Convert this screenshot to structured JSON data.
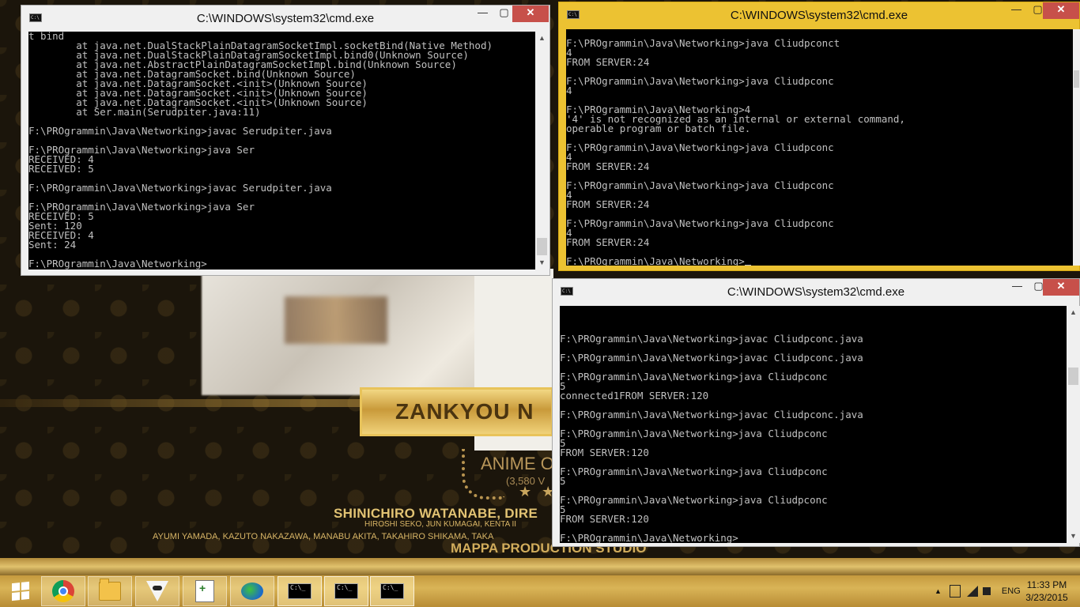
{
  "wallpaper": {
    "banner_text": "ZANKYOU N",
    "anime_of": "ANIME OF",
    "count": "(3,580 V",
    "stars": "★ ★",
    "line1": "SHINICHIRO WATANABE, DIRE",
    "line2": "HIROSHI SEKO, JUN KUMAGAI, KENTA II",
    "line3": "AYUMI YAMADA, KAZUTO NAKAZAWA, MANABU AKITA, TAKAHIRO SHIKAMA, TAKA",
    "line4": "MAPPA PRODUCTION STUDIO"
  },
  "windows": {
    "left": {
      "title": "C:\\WINDOWS\\system32\\cmd.exe",
      "icon_label": "C:\\",
      "minimize": "—",
      "maximize": "▢",
      "close": "✕",
      "lines": [
        "t bind",
        "        at java.net.DualStackPlainDatagramSocketImpl.socketBind(Native Method)",
        "        at java.net.DualStackPlainDatagramSocketImpl.bind0(Unknown Source)",
        "        at java.net.AbstractPlainDatagramSocketImpl.bind(Unknown Source)",
        "        at java.net.DatagramSocket.bind(Unknown Source)",
        "        at java.net.DatagramSocket.<init>(Unknown Source)",
        "        at java.net.DatagramSocket.<init>(Unknown Source)",
        "        at java.net.DatagramSocket.<init>(Unknown Source)",
        "        at Ser.main(Serudpiter.java:11)",
        "",
        "F:\\PROgrammin\\Java\\Networking>javac Serudpiter.java",
        "",
        "F:\\PROgrammin\\Java\\Networking>java Ser",
        "RECEIVED: 4",
        "RECEIVED: 5",
        "",
        "F:\\PROgrammin\\Java\\Networking>javac Serudpiter.java",
        "",
        "F:\\PROgrammin\\Java\\Networking>java Ser",
        "RECEIVED: 5",
        "Sent: 120",
        "RECEIVED: 4",
        "Sent: 24",
        "",
        "F:\\PROgrammin\\Java\\Networking>"
      ]
    },
    "right_top": {
      "title": "C:\\WINDOWS\\system32\\cmd.exe",
      "icon_label": "C:\\",
      "minimize": "—",
      "maximize": "▢",
      "close": "✕",
      "lines": [
        "",
        "F:\\PROgrammin\\Java\\Networking>java Cliudpconct",
        "4",
        "FROM SERVER:24",
        "",
        "F:\\PROgrammin\\Java\\Networking>java Cliudpconc",
        "4",
        "",
        "F:\\PROgrammin\\Java\\Networking>4",
        "'4' is not recognized as an internal or external command,",
        "operable program or batch file.",
        "",
        "F:\\PROgrammin\\Java\\Networking>java Cliudpconc",
        "4",
        "FROM SERVER:24",
        "",
        "F:\\PROgrammin\\Java\\Networking>java Cliudpconc",
        "4",
        "FROM SERVER:24",
        "",
        "F:\\PROgrammin\\Java\\Networking>java Cliudpconc",
        "4",
        "FROM SERVER:24",
        "",
        "F:\\PROgrammin\\Java\\Networking>"
      ]
    },
    "right_bottom": {
      "title": "C:\\WINDOWS\\system32\\cmd.exe",
      "icon_label": "C:\\",
      "minimize": "—",
      "maximize": "▢",
      "close": "✕",
      "lines": [
        "",
        "",
        "",
        "F:\\PROgrammin\\Java\\Networking>javac Cliudpconc.java",
        "",
        "F:\\PROgrammin\\Java\\Networking>javac Cliudpconc.java",
        "",
        "F:\\PROgrammin\\Java\\Networking>java Cliudpconc",
        "5",
        "connected1FROM SERVER:120",
        "",
        "F:\\PROgrammin\\Java\\Networking>javac Cliudpconc.java",
        "",
        "F:\\PROgrammin\\Java\\Networking>java Cliudpconc",
        "5",
        "FROM SERVER:120",
        "",
        "F:\\PROgrammin\\Java\\Networking>java Cliudpconc",
        "5",
        "",
        "F:\\PROgrammin\\Java\\Networking>java Cliudpconc",
        "5",
        "FROM SERVER:120",
        "",
        "F:\\PROgrammin\\Java\\Networking>"
      ]
    }
  },
  "taskbar": {
    "pinned": [
      {
        "name": "start-button",
        "icon": "windows-logo-icon"
      },
      {
        "name": "chrome-button",
        "icon": "chrome-icon"
      },
      {
        "name": "file-explorer-button",
        "icon": "folder-icon"
      },
      {
        "name": "filezilla-button",
        "icon": "fox-icon"
      },
      {
        "name": "notepad-plus-plus-button",
        "icon": "notepad-icon"
      },
      {
        "name": "internet-download-manager-button",
        "icon": "globe-download-icon"
      },
      {
        "name": "cmd-window-1-button",
        "icon": "cmd-icon"
      },
      {
        "name": "cmd-window-2-button",
        "icon": "cmd-icon"
      },
      {
        "name": "cmd-window-3-button",
        "icon": "cmd-icon"
      }
    ],
    "tray": {
      "chevron": "▲",
      "language": "ENG",
      "time": "11:33 PM",
      "date": "3/23/2015"
    }
  }
}
